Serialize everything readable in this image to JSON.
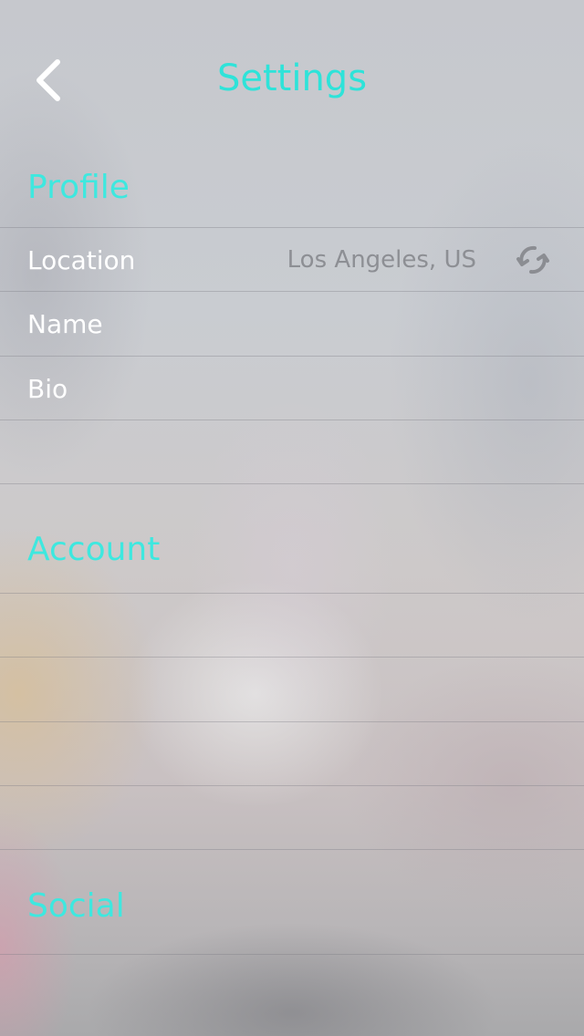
{
  "header": {
    "title": "Settings"
  },
  "sections": {
    "profile": {
      "title": "Profile",
      "location_label": "Location",
      "location_value": "Los Angeles, US",
      "name_label": "Name",
      "bio_label": "Bio"
    },
    "account": {
      "title": "Account"
    },
    "social": {
      "title": "Social"
    }
  },
  "icons": {
    "back": "chevron-left-icon",
    "refresh": "refresh-icon"
  },
  "colors": {
    "accent": "#2ee3d9",
    "row_text": "#ffffff",
    "value_text": "#8d8f94"
  }
}
